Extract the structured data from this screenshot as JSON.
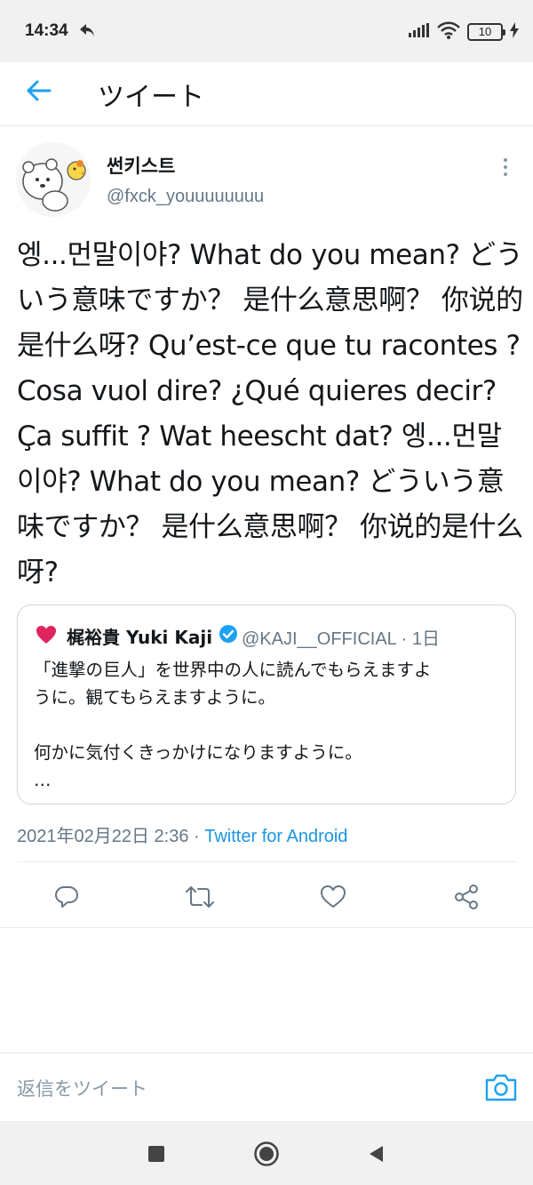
{
  "status_bar": {
    "time": "14:34",
    "battery": "10"
  },
  "header": {
    "title": "ツイート"
  },
  "tweet": {
    "display_name": "썬키스트",
    "handle": "@fxck_youuuuuuuu",
    "text": "엥...먼말이야? What do you mean? どういう意味ですか？ 是什么意思啊？ 你说的是什么呀? Qu’est-ce que tu racontes ? Cosa vuol dire? ¿Qué quieres decir? Ça suffit ? Wat heescht dat? 엥...먼말이야? What do you mean? どういう意味ですか？ 是什么意思啊？ 你说的是什么呀?",
    "timestamp": "2021年02月22日 2:36 · ",
    "source": "Twitter for Android"
  },
  "quoted_tweet": {
    "display_name": "梶裕貴 Yuki Kaji",
    "handle_time": "@KAJI__OFFICIAL · 1日",
    "line1": "「進撃の巨人」を世界中の人に読んでもらえますよ",
    "line2": "うに。観てもらえますように。",
    "line3": "何かに気付くきっかけになりますように。",
    "line4": "…"
  },
  "reply": {
    "placeholder": "返信をツイート"
  },
  "colors": {
    "accent": "#1da1f2",
    "secondary_text": "#657786",
    "heart": "#e0245e",
    "verified": "#1da1f2"
  },
  "icons": {
    "actions": [
      "reply-icon",
      "retweet-icon",
      "like-icon",
      "share-icon"
    ],
    "nav": [
      "recents-square-icon",
      "home-circle-icon",
      "back-triangle-icon"
    ]
  }
}
